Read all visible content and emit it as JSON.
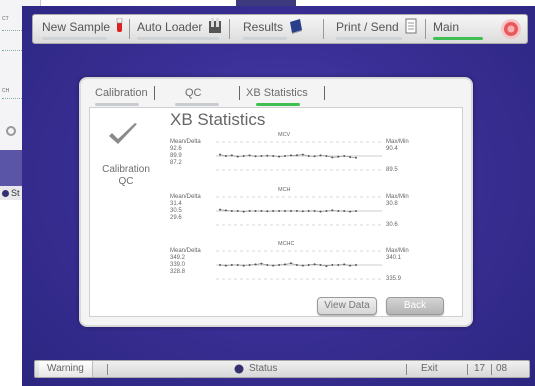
{
  "toolbar": {
    "new_sample": "New Sample",
    "auto_loader": "Auto Loader",
    "results": "Results",
    "print_send": "Print / Send",
    "main": "Main"
  },
  "tabs": {
    "calibration": "Calibration",
    "qc": "QC",
    "xb_statistics": "XB Statistics"
  },
  "sidebar_label": {
    "line1": "Calibration",
    "line2": "QC"
  },
  "page_title": "XB Statistics",
  "charts": [
    {
      "name": "MCV",
      "left_header": "Mean/Delta",
      "mean": "92.6",
      "center": "89.9",
      "delta": "87.2",
      "right_header": "Max/Min",
      "max": "90.4",
      "min": "89.5",
      "points": [
        0.55,
        0.5,
        0.52,
        0.48,
        0.5,
        0.52,
        0.49,
        0.5,
        0.51,
        0.5,
        0.48,
        0.5,
        0.52,
        0.53,
        0.55,
        0.5,
        0.49,
        0.52,
        0.5,
        0.45,
        0.47,
        0.5,
        0.46,
        0.44
      ]
    },
    {
      "name": "MCH",
      "left_header": "Mean/Delta",
      "mean": "31.4",
      "center": "30.5",
      "delta": "29.6",
      "right_header": "Max/Min",
      "max": "30.8",
      "min": "30.6",
      "points": [
        0.55,
        0.52,
        0.5,
        0.5,
        0.48,
        0.5,
        0.5,
        0.5,
        0.49,
        0.5,
        0.5,
        0.5,
        0.5,
        0.5,
        0.49,
        0.5,
        0.5,
        0.48,
        0.5,
        0.52,
        0.5,
        0.5,
        0.48,
        0.5
      ]
    },
    {
      "name": "MCHC",
      "left_header": "Mean/Delta",
      "mean": "349.2",
      "center": "339.0",
      "delta": "328.8",
      "right_header": "Max/Min",
      "max": "340.1",
      "min": "335.9",
      "points": [
        0.5,
        0.48,
        0.5,
        0.5,
        0.48,
        0.5,
        0.52,
        0.55,
        0.5,
        0.48,
        0.5,
        0.52,
        0.56,
        0.5,
        0.48,
        0.5,
        0.53,
        0.5,
        0.46,
        0.5,
        0.5,
        0.52,
        0.48,
        0.5
      ]
    }
  ],
  "buttons": {
    "view_data": "View Data",
    "back": "Back"
  },
  "status": {
    "warning": "Warning",
    "status": "Status",
    "exit": "Exit",
    "time_a": "17",
    "time_b": "08"
  },
  "background_window": {
    "stub1": "CT",
    "stub2": "CH",
    "status": "St"
  },
  "colors": {
    "accent_green": "#3fbf52",
    "screen_bg": "#3a2f96"
  }
}
